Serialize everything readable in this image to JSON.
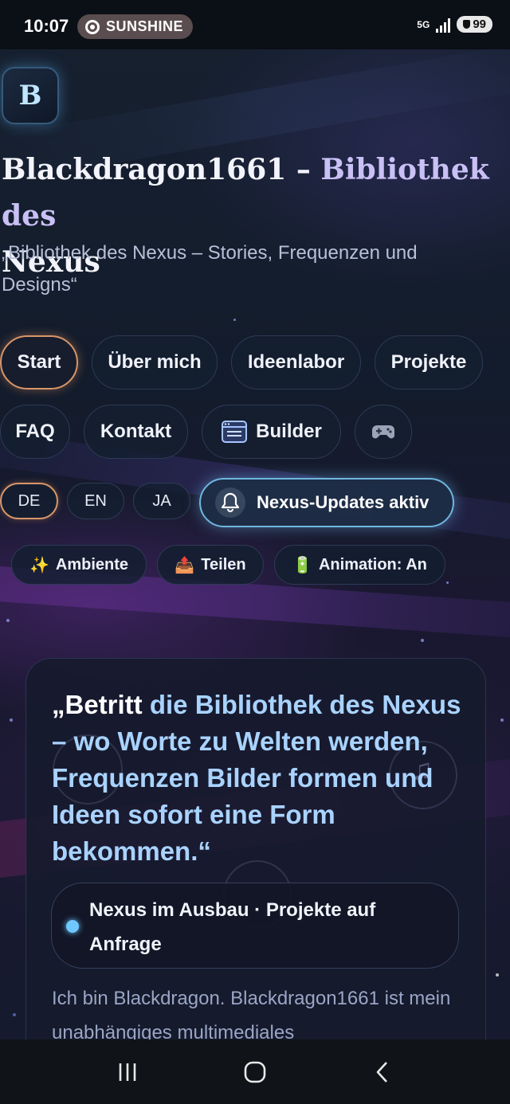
{
  "status_bar": {
    "time": "10:07",
    "app_pill": "SUNSHINE",
    "network": "5G",
    "battery": "99"
  },
  "header": {
    "logo_letter": "B",
    "title_main": "Blackdragon1661 – ",
    "title_highlight": "Bibliothek des",
    "title_line2": "Nexus",
    "subtitle": "„Bibliothek des Nexus – Stories, Frequenzen und Designs“"
  },
  "nav": {
    "start": "Start",
    "about": "Über mich",
    "lab": "Ideenlabor",
    "projects": "Projekte",
    "faq": "FAQ",
    "contact": "Kontakt",
    "builder": "Builder",
    "game_icon": "gamepad-icon"
  },
  "languages": {
    "de": "DE",
    "en": "EN",
    "ja": "JA"
  },
  "notifications": {
    "label": "Nexus-Updates aktiv"
  },
  "toolbar": {
    "ambient": "Ambiente",
    "ambient_icon": "✨",
    "share": "Teilen",
    "share_icon": "📤",
    "animation": "Animation: An",
    "animation_icon": "🔋"
  },
  "card": {
    "quote_open": "„Betritt",
    "quote_rest": " die Bibliothek des Nexus – wo Worte zu Welten werden, Frequenzen Bilder formen und Ideen sofort eine Form bekommen.“",
    "status": "Nexus im Ausbau · Projekte auf Anfrage",
    "intro": "Ich bin Blackdragon. Blackdragon1661 ist mein unabhängiges multimediales"
  },
  "colors": {
    "accent_orange": "#d89668",
    "accent_blue": "#6fb7e0",
    "quote_blue": "#a9d3ff"
  }
}
